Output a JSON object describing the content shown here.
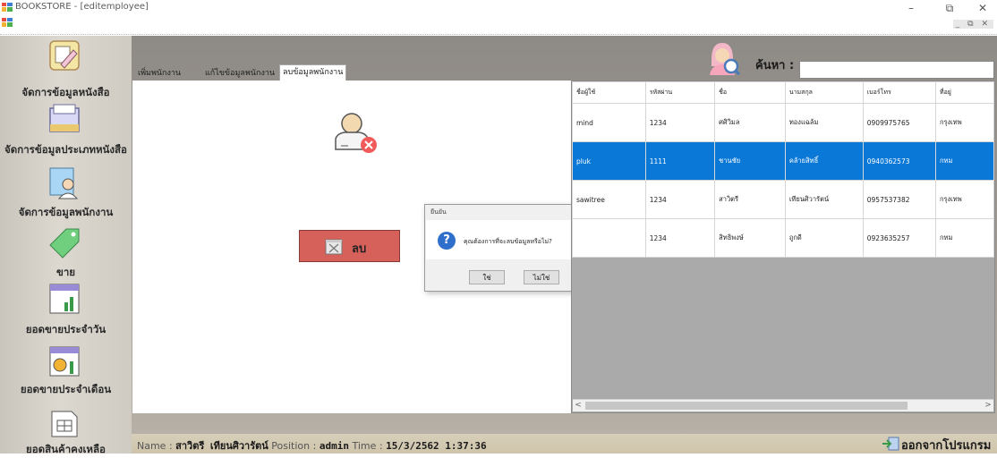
{
  "window": {
    "title": "BOOKSTORE - [editemployee]",
    "minimize": "–",
    "maximize": "⧉",
    "close": "✕",
    "mdi_controls": "_ ⧉ ✕"
  },
  "sidebar": {
    "items": [
      {
        "label": "จัดการข้อมูลหนังสือ",
        "icon": "book-edit-icon"
      },
      {
        "label": "จัดการข้อมูลประเภทหนังสือ",
        "icon": "book-category-icon"
      },
      {
        "label": "จัดการข้อมูลพนักงาน",
        "icon": "employee-icon"
      },
      {
        "label": "ขาย",
        "icon": "price-tag-icon"
      },
      {
        "label": "ยอดขายประจำวัน",
        "icon": "daily-chart-icon"
      },
      {
        "label": "ยอดขายประจำเดือน",
        "icon": "monthly-chart-icon"
      },
      {
        "label": "ยอดสินค้าคงเหลือ",
        "icon": "stock-calendar-icon"
      }
    ]
  },
  "tabs": [
    {
      "label": "เพิ่มพนักงาน"
    },
    {
      "label": "แก้ไขข้อมูลพนักงาน"
    },
    {
      "label": "ลบข้อมูลพนักงาน"
    }
  ],
  "delete_button": {
    "label": "ลบ"
  },
  "dialog": {
    "title": "ยืนยัน",
    "message": "คุณต้องการที่จะลบข้อมูลหรือไม่?",
    "icon": "?",
    "yes": "ใช่",
    "no": "ไม่ใช่"
  },
  "search": {
    "label": "ค้นหา :",
    "value": ""
  },
  "grid": {
    "columns": [
      "ชื่อผู้ใช้",
      "รหัสผ่าน",
      "ชื่อ",
      "นามสกุล",
      "เบอร์โทร",
      "ที่อยู่"
    ],
    "rows": [
      [
        "mind",
        "1234",
        "ศศิวิมล",
        "ทองแฉล้ม",
        "0909975765",
        "กรุงเทพ"
      ],
      [
        "pluk",
        "1111",
        "ชานชัย",
        "คล้ายสิทธิ์",
        "0940362573",
        "กทม"
      ],
      [
        "sawitree",
        "1234",
        "สาวิตรี",
        "เทียนศิวารัตน์",
        "0957537382",
        "กรุงเทพ"
      ],
      [
        "",
        "1234",
        "สิทธิพงษ์",
        "ถูกดี",
        "0923635257",
        "กทม"
      ]
    ],
    "selected_row": 1
  },
  "status": {
    "name_label": "Name :",
    "name_value": "สาวิตรี เทียนศิวารัตน์",
    "position_label": "Position :",
    "position_value": "admin",
    "time_label": "Time :",
    "time_value": "15/3/2562 1:37:36"
  },
  "exit": {
    "label": "ออกจากโปรแกรม"
  },
  "colors": {
    "selected_row": "#0a78d7",
    "delete_button": "#d6605a",
    "sidebar": "#d4d0c8"
  }
}
